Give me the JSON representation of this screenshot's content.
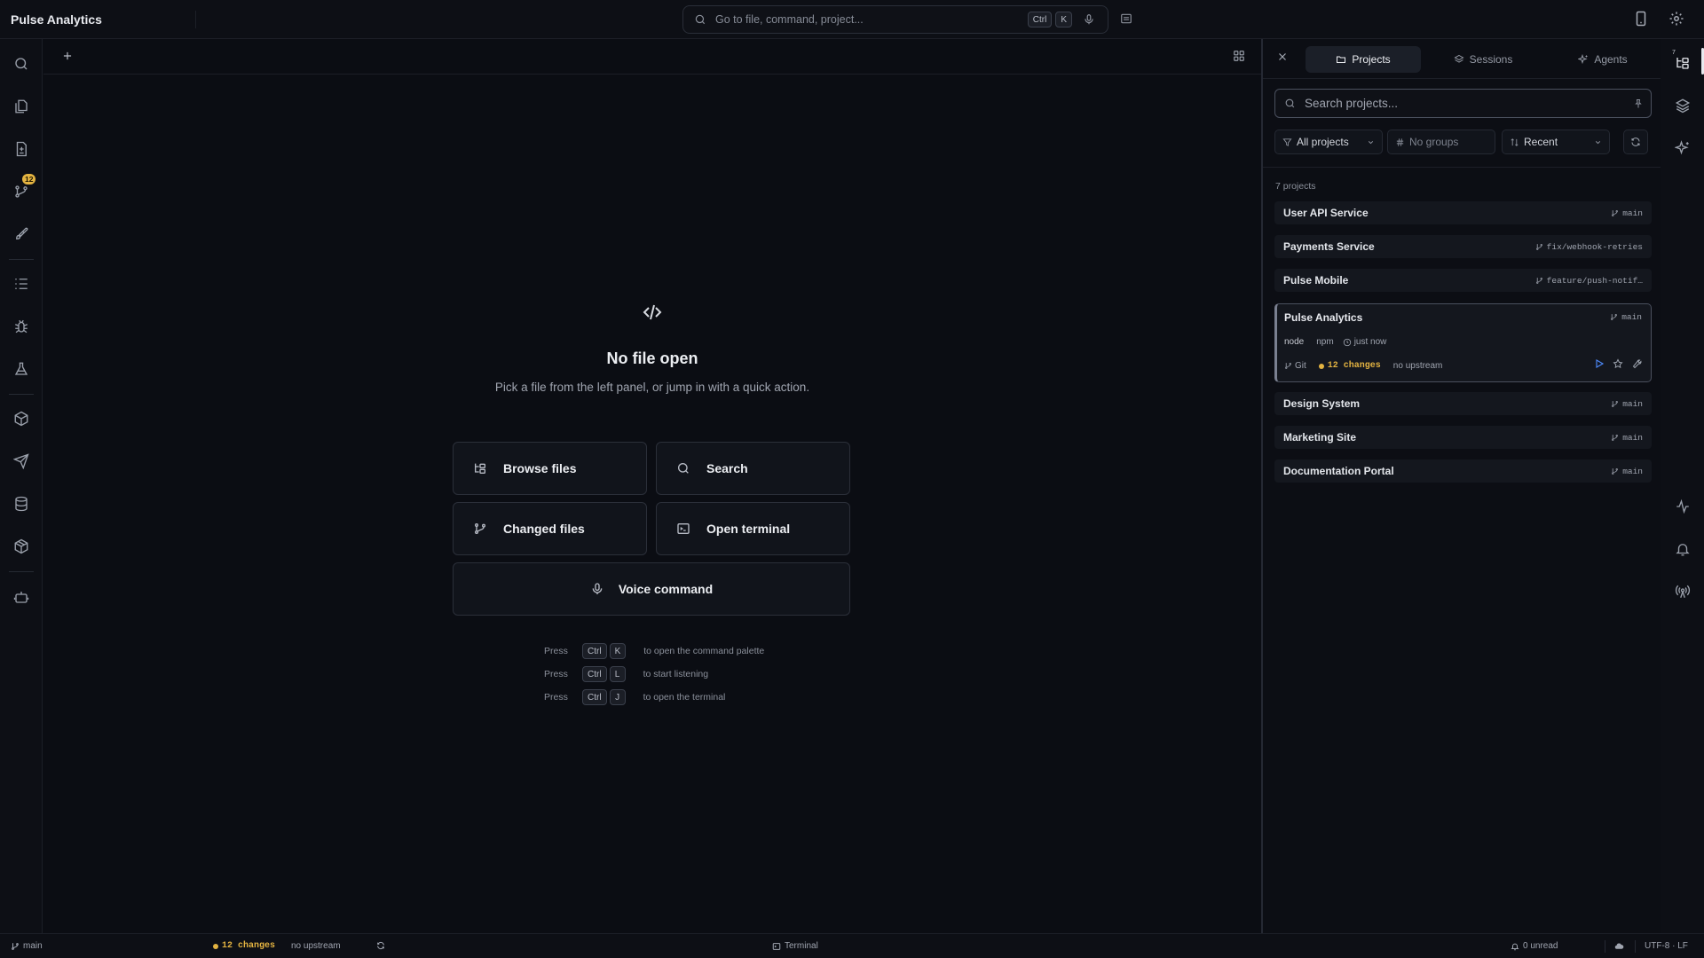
{
  "app": {
    "title": "Pulse Analytics"
  },
  "command_search": {
    "placeholder": "Go to file, command, project...",
    "shortcut_modifier": "Ctrl",
    "shortcut_key": "K"
  },
  "left_rail": {
    "badge_count": "12",
    "icons": [
      "search-icon",
      "files-icon",
      "changes-icon",
      "git-branch-icon",
      "rocket-icon",
      "tasks-icon",
      "bug-icon",
      "flask-icon",
      "package-icon",
      "send-icon",
      "database-icon",
      "box-icon",
      "bot-icon"
    ]
  },
  "editor": {
    "empty_title": "No file open",
    "empty_subtitle": "Pick a file from the left panel, or jump in with a quick action.",
    "quick_actions": {
      "browse": "Browse files",
      "search": "Search",
      "changed": "Changed files",
      "terminal": "Open terminal",
      "voice": "Voice command"
    },
    "hints": [
      {
        "press": "Press",
        "mod": "Ctrl",
        "key": "K",
        "text": "to open the command palette"
      },
      {
        "press": "Press",
        "mod": "Ctrl",
        "key": "L",
        "text": "to start listening"
      },
      {
        "press": "Press",
        "mod": "Ctrl",
        "key": "J",
        "text": "to open the terminal"
      }
    ]
  },
  "panel": {
    "tabs": {
      "projects": "Projects",
      "sessions": "Sessions",
      "agents": "Agents"
    },
    "search_placeholder": "Search projects...",
    "filters": {
      "scope": "All projects",
      "groups": "No groups",
      "sort": "Recent"
    },
    "count": "7 projects",
    "projects": [
      {
        "name": "User API Service",
        "branch": "main"
      },
      {
        "name": "Payments Service",
        "branch": "fix/webhook-retries"
      },
      {
        "name": "Pulse Mobile",
        "branch": "feature/push-notif…"
      },
      {
        "name": "Pulse Analytics",
        "branch": "main",
        "stack1": "node",
        "stack2": "npm",
        "updated": "just now",
        "vcs": "Git",
        "changes": "12 changes",
        "upstream": "no upstream"
      },
      {
        "name": "Design System",
        "branch": "main"
      },
      {
        "name": "Marketing Site",
        "branch": "main"
      },
      {
        "name": "Documentation Portal",
        "branch": "main"
      }
    ]
  },
  "right_rail": {
    "projects_count": "7"
  },
  "status": {
    "branch": "main",
    "changes": "12 changes",
    "upstream": "no upstream",
    "terminal": "Terminal",
    "unread": "0 unread",
    "encoding": "UTF-8 · LF"
  },
  "colors": {
    "accent_yellow": "#e3b341",
    "play_blue": "#4f8cff",
    "background": "#0b0d13"
  }
}
